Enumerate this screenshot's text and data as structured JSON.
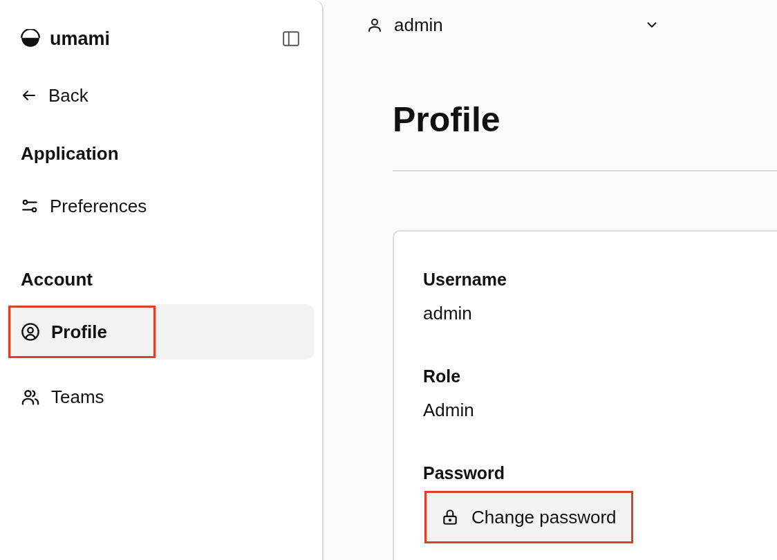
{
  "sidebar": {
    "brand": "umami",
    "back": "Back",
    "sections": [
      {
        "heading": "Application",
        "items": [
          {
            "label": "Preferences",
            "kind": "sliders",
            "selected": false,
            "highlighted": false
          }
        ]
      },
      {
        "heading": "Account",
        "items": [
          {
            "label": "Profile",
            "kind": "user-circle",
            "selected": true,
            "highlighted": true
          },
          {
            "label": "Teams",
            "kind": "users",
            "selected": false,
            "highlighted": false
          }
        ]
      }
    ]
  },
  "header": {
    "user": "admin"
  },
  "page": {
    "title": "Profile"
  },
  "profile": {
    "fields": [
      {
        "label": "Username",
        "value": "admin"
      },
      {
        "label": "Role",
        "value": "Admin"
      }
    ],
    "password": {
      "label": "Password",
      "button": "Change password",
      "highlighted": true
    }
  }
}
